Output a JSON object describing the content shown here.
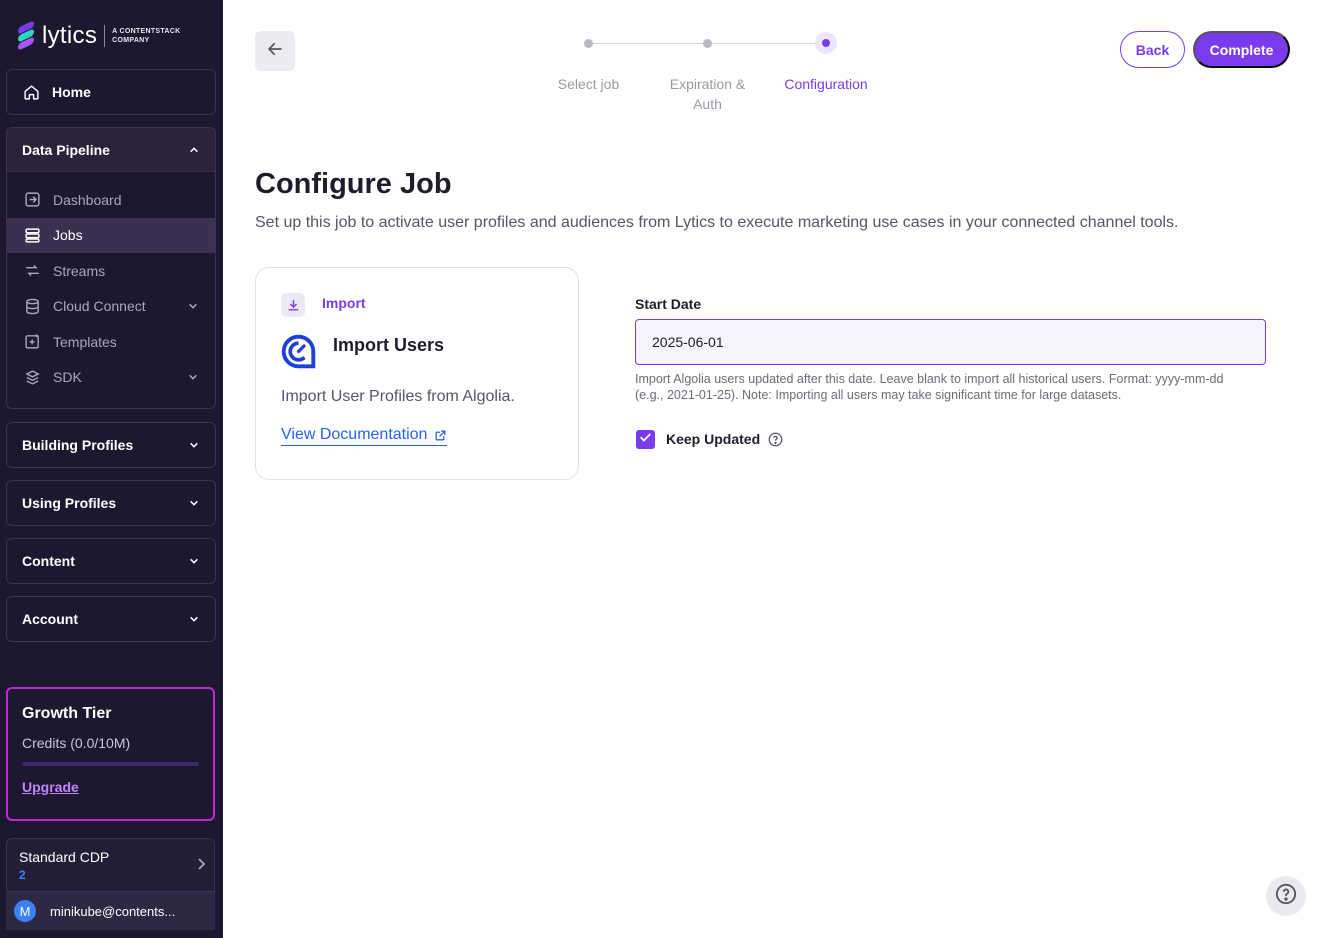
{
  "brand": {
    "name": "lytics",
    "sub_line1": "A CONTENTSTACK",
    "sub_line2": "COMPANY"
  },
  "sidebar": {
    "home": {
      "label": "Home",
      "icon": "home-icon"
    },
    "data_pipeline": {
      "label": "Data Pipeline",
      "items": [
        {
          "label": "Dashboard",
          "icon": "dashboard-icon",
          "active": false
        },
        {
          "label": "Jobs",
          "icon": "jobs-icon",
          "active": true
        },
        {
          "label": "Streams",
          "icon": "streams-icon",
          "active": false
        },
        {
          "label": "Cloud Connect",
          "icon": "database-icon",
          "active": false,
          "expandable": true
        },
        {
          "label": "Templates",
          "icon": "templates-icon",
          "active": false
        },
        {
          "label": "SDK",
          "icon": "sdk-icon",
          "active": false,
          "expandable": true
        }
      ]
    },
    "sections": [
      {
        "label": "Building Profiles"
      },
      {
        "label": "Using Profiles"
      },
      {
        "label": "Content"
      },
      {
        "label": "Account"
      }
    ],
    "tier": {
      "title": "Growth Tier",
      "credits": "Credits (0.0/10M)",
      "progress": 0.0,
      "upgrade": "Upgrade"
    },
    "account": {
      "name": "Standard CDP",
      "number": "2"
    },
    "user": {
      "initial": "M",
      "email": "minikube@contents..."
    }
  },
  "stepper": {
    "steps": [
      {
        "label": "Select job",
        "state": "done"
      },
      {
        "label": "Expiration & Auth",
        "label_line1": "Expiration &",
        "label_line2": "Auth",
        "state": "done"
      },
      {
        "label": "Configuration",
        "state": "active"
      }
    ]
  },
  "header": {
    "back_label": "Back",
    "complete_label": "Complete"
  },
  "main": {
    "title": "Configure Job",
    "description": "Set up this job to activate user profiles and audiences from Lytics to execute marketing use cases in your connected channel tools."
  },
  "card": {
    "badge": "Import",
    "title": "Import Users",
    "description": "Import User Profiles from Algolia.",
    "link": "View Documentation"
  },
  "form": {
    "start_date": {
      "label": "Start Date",
      "value": "2025-06-01",
      "help": "Import Algolia users updated after this date. Leave blank to import all historical users. Format: yyyy-mm-dd (e.g., 2021-01-25). Note: Importing all users may take significant time for large datasets."
    },
    "keep_updated": {
      "label": "Keep Updated",
      "checked": true
    }
  },
  "colors": {
    "accent": "#7c3aed",
    "sidebar_bg": "#1e1730",
    "link": "#2563eb",
    "tier_border": "#c026d3"
  }
}
